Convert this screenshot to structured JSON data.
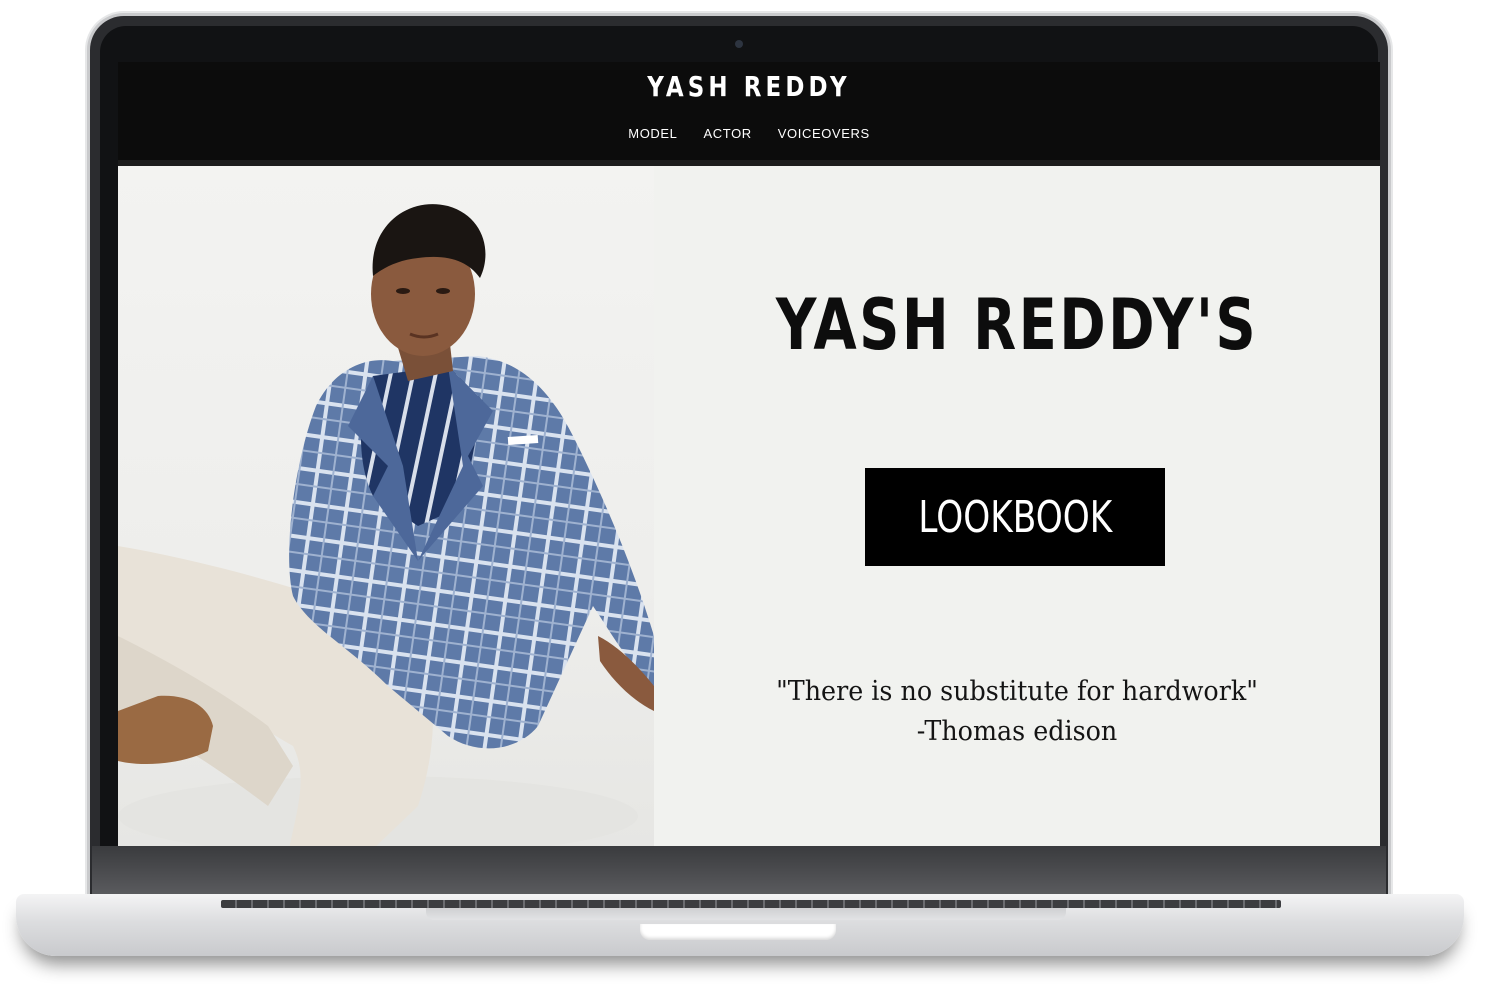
{
  "site": {
    "title": "YASH REDDY",
    "nav": {
      "items": [
        {
          "label": "MODEL"
        },
        {
          "label": "ACTOR"
        },
        {
          "label": "VOICEOVERS"
        }
      ]
    }
  },
  "hero": {
    "heading": "YASH REDDY'S",
    "button_label": "LOOKBOOK",
    "quote_text": "\"There is no substitute for hardwork\"",
    "quote_author": "-Thomas edison"
  },
  "colors": {
    "header_bg": "#0c0c0c",
    "page_bg": "#f1f2ef",
    "button_bg": "#000000",
    "text": "#0d0d0d"
  }
}
